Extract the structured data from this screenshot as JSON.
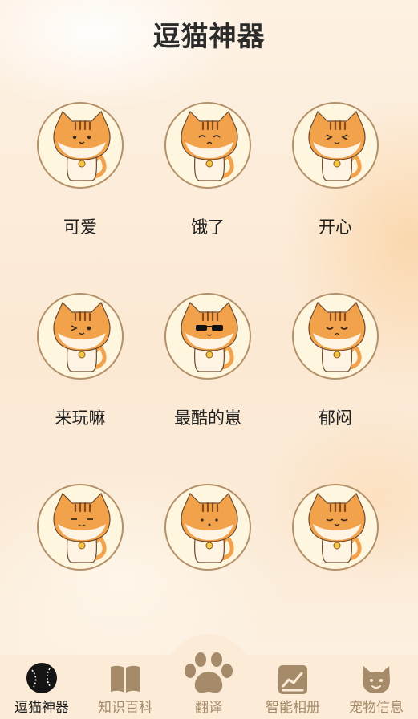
{
  "header": {
    "title": "逗猫神器"
  },
  "cats": [
    {
      "label": "可爱"
    },
    {
      "label": "饿了"
    },
    {
      "label": "开心"
    },
    {
      "label": "来玩嘛"
    },
    {
      "label": "最酷的崽"
    },
    {
      "label": "郁闷"
    },
    {
      "label": ""
    },
    {
      "label": ""
    },
    {
      "label": ""
    }
  ],
  "tabs": [
    {
      "label": "逗猫神器",
      "icon": "baseball-icon",
      "active": true
    },
    {
      "label": "知识百科",
      "icon": "book-icon",
      "active": false
    },
    {
      "label": "翻译",
      "icon": "paw-icon",
      "active": false
    },
    {
      "label": "智能相册",
      "icon": "photo-album-icon",
      "active": false
    },
    {
      "label": "宠物信息",
      "icon": "cat-face-icon",
      "active": false
    }
  ],
  "colors": {
    "accent": "#f2a24a",
    "tab_icon": "#a58b6a",
    "circle_border": "#b39068"
  }
}
